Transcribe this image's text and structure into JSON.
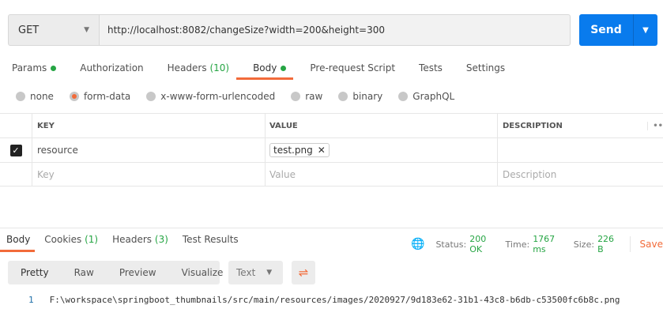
{
  "request": {
    "method": "GET",
    "url": "http://localhost:8082/changeSize?width=200&height=300",
    "send_label": "Send"
  },
  "tabs": [
    {
      "label": "Params"
    },
    {
      "label": "Authorization"
    },
    {
      "label": "Headers",
      "count": "(10)"
    },
    {
      "label": "Body"
    },
    {
      "label": "Pre-request Script"
    },
    {
      "label": "Tests"
    },
    {
      "label": "Settings"
    }
  ],
  "body_modes": [
    "none",
    "form-data",
    "x-www-form-urlencoded",
    "raw",
    "binary",
    "GraphQL"
  ],
  "table": {
    "headers": [
      "KEY",
      "VALUE",
      "DESCRIPTION"
    ],
    "rows": [
      {
        "key": "resource",
        "value": "test.png",
        "description": ""
      }
    ],
    "placeholders": {
      "key": "Key",
      "value": "Value",
      "description": "Description"
    },
    "more": "••"
  },
  "response": {
    "tabs": [
      {
        "label": "Body"
      },
      {
        "label": "Cookies",
        "count": "(1)"
      },
      {
        "label": "Headers",
        "count": "(3)"
      },
      {
        "label": "Test Results"
      }
    ],
    "status_label": "Status:",
    "status": "200 OK",
    "time_label": "Time:",
    "time": "1767 ms",
    "size_label": "Size:",
    "size": "226 B",
    "save": "Save",
    "views": [
      "Pretty",
      "Raw",
      "Preview",
      "Visualize"
    ],
    "format": "Text",
    "lines": [
      {
        "n": "1",
        "text": "F:\\workspace\\springboot_thumbnails/src/main/resources/images/2020927/9d183e62-31b1-43c8-b6db-c53500fc6b8c.png"
      }
    ]
  }
}
